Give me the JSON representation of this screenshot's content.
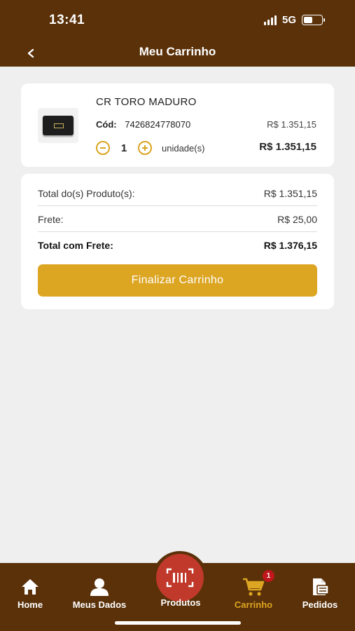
{
  "status_bar": {
    "time": "13:41",
    "network": "5G"
  },
  "header": {
    "title": "Meu Carrinho",
    "back_icon": "chevron-left-icon"
  },
  "cart_item": {
    "name": "CR TORO MADURO",
    "code_label": "Cód:",
    "code": "7426824778070",
    "unit_price": "R$ 1.351,15",
    "quantity": "1",
    "unit_label": "unidade(s)",
    "line_total": "R$ 1.351,15"
  },
  "summary": {
    "products_label": "Total do(s) Produto(s):",
    "products_value": "R$ 1.351,15",
    "shipping_label": "Frete:",
    "shipping_value": "R$ 25,00",
    "total_label": "Total com Frete:",
    "total_value": "R$ 1.376,15",
    "finalize_button": "Finalizar Carrinho"
  },
  "tabbar": {
    "home": "Home",
    "meus_dados": "Meus Dados",
    "produtos": "Produtos",
    "carrinho": "Carrinho",
    "carrinho_badge": "1",
    "pedidos": "Pedidos",
    "active": "carrinho"
  },
  "colors": {
    "brand_brown": "#5a3109",
    "accent_gold": "#dca522",
    "produtos_red": "#c0392b",
    "badge_red": "#c0171c",
    "background": "#efefef"
  }
}
